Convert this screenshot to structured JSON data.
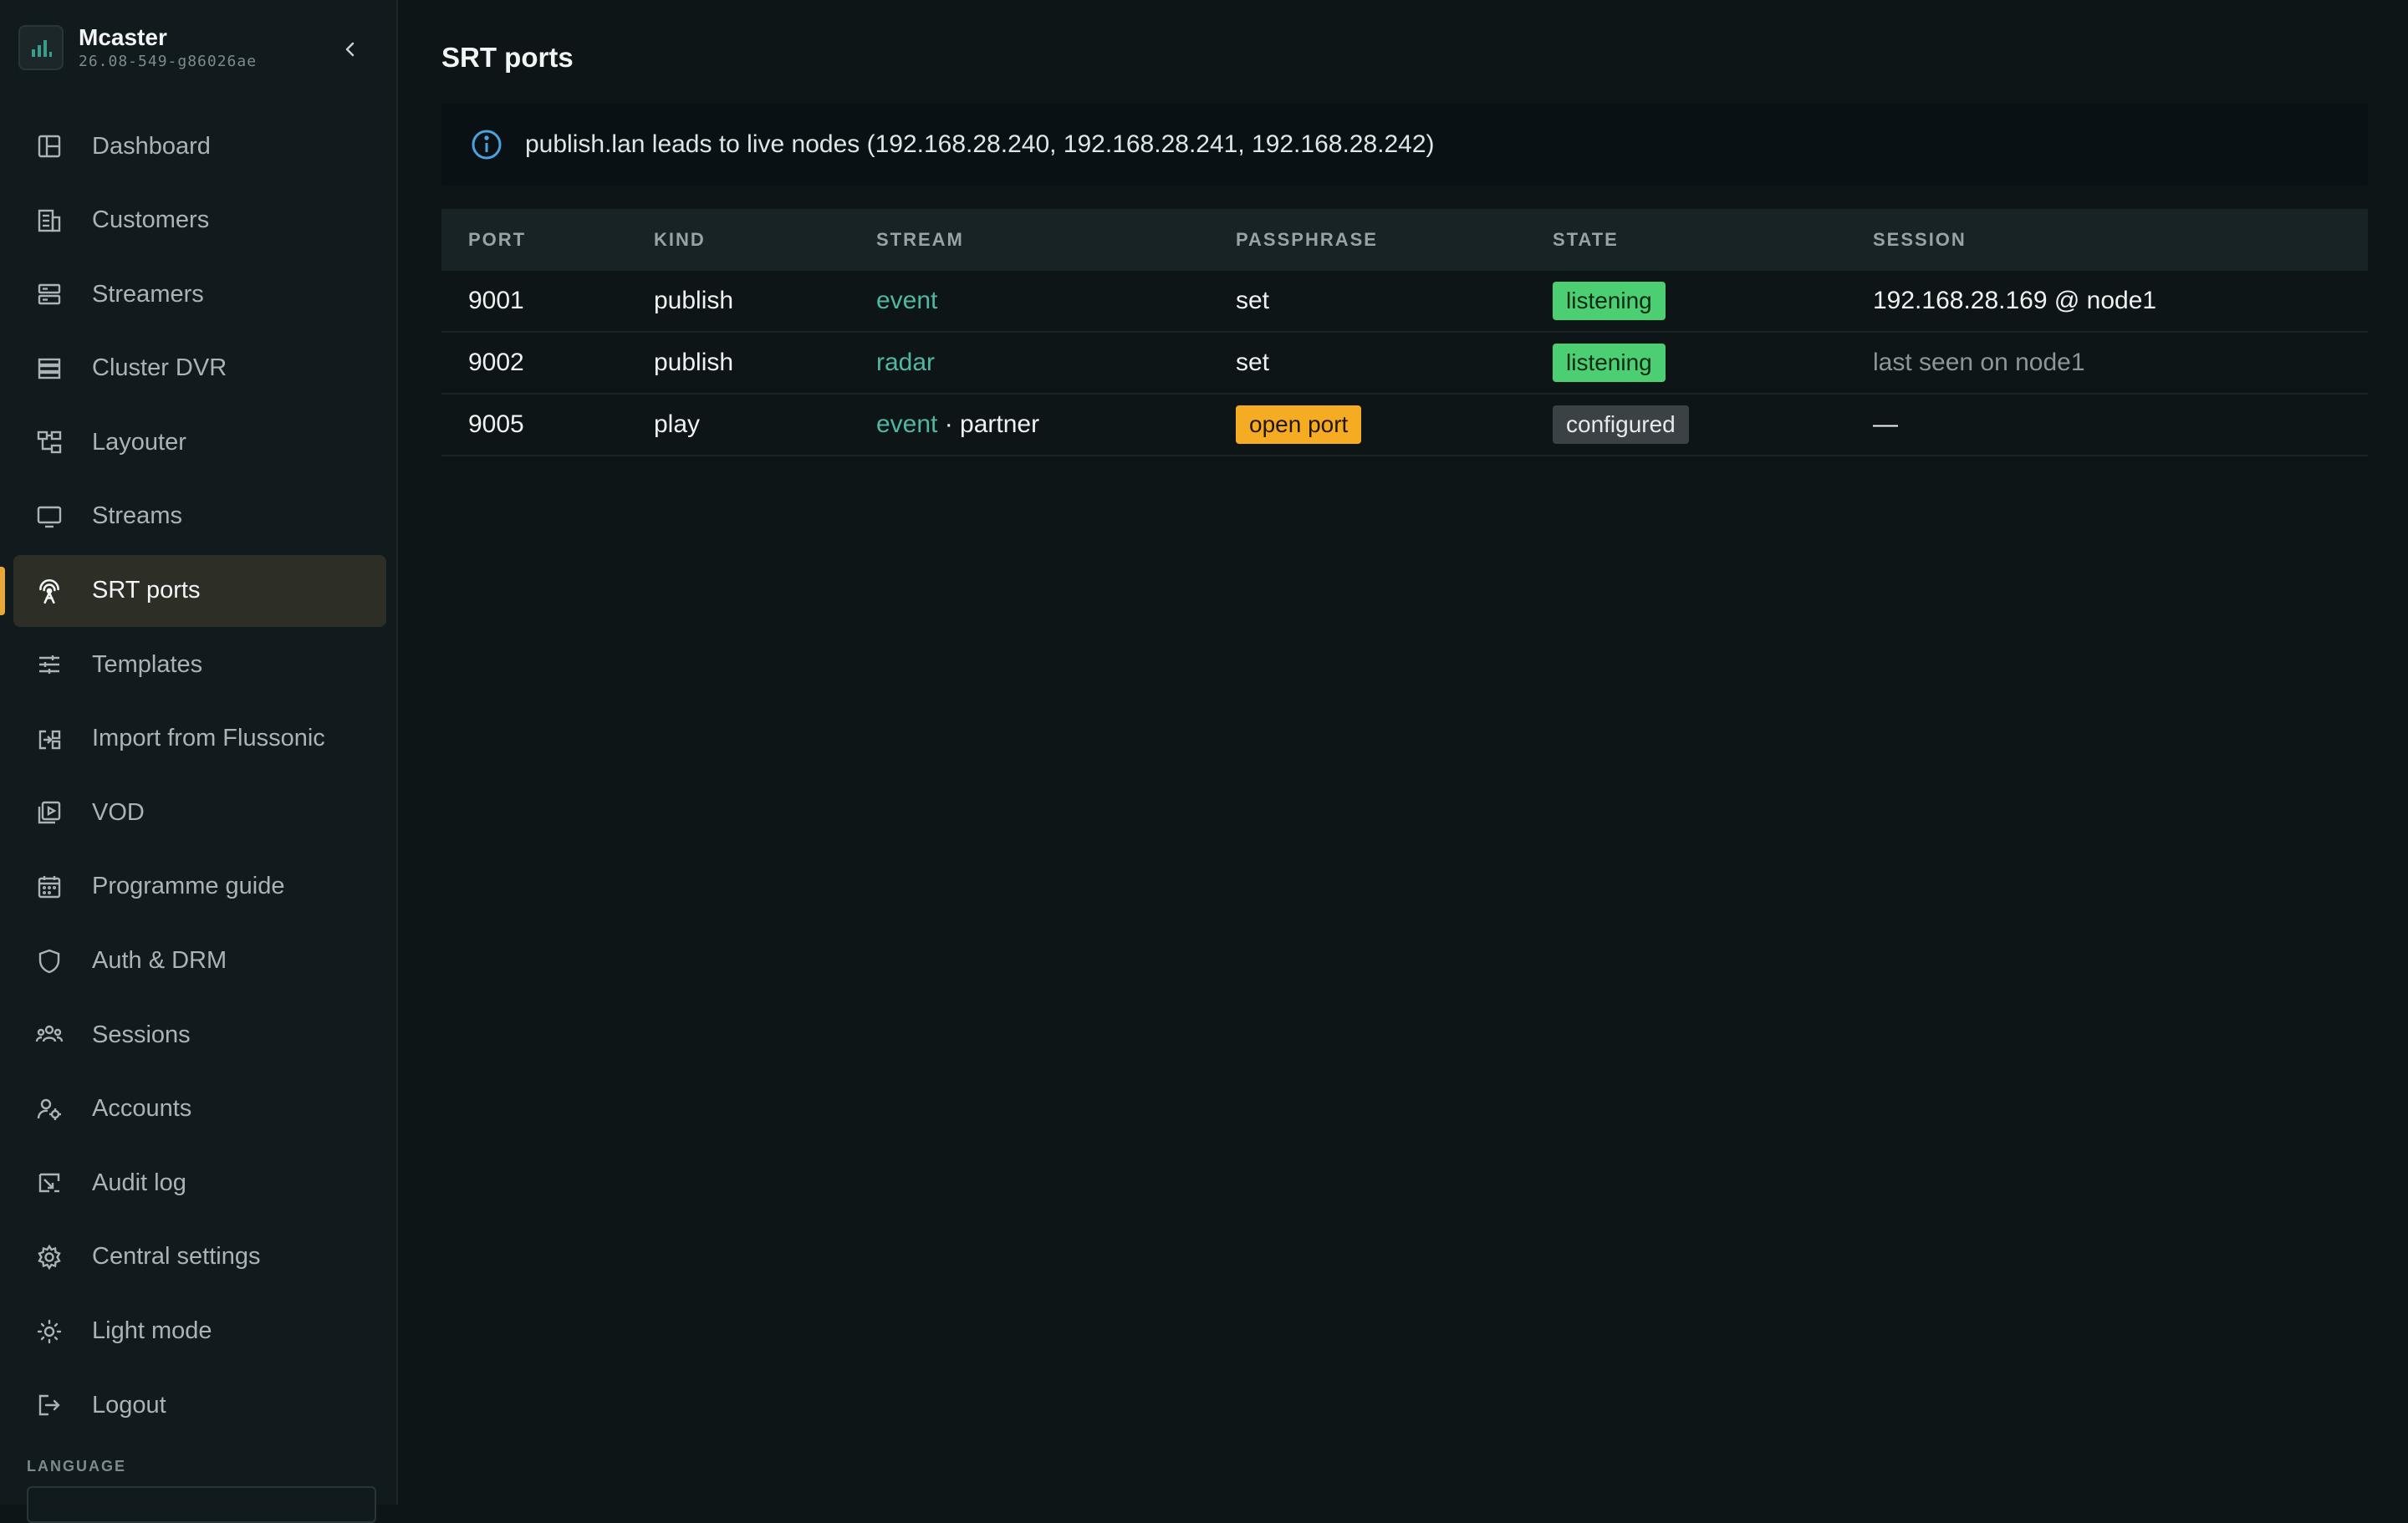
{
  "app": {
    "name": "Mcaster",
    "version": "26.08-549-g86026ae"
  },
  "sidebar": {
    "items": [
      {
        "label": "Dashboard",
        "icon": "dashboard-icon"
      },
      {
        "label": "Customers",
        "icon": "building-icon"
      },
      {
        "label": "Streamers",
        "icon": "server-icon"
      },
      {
        "label": "Cluster DVR",
        "icon": "storage-icon"
      },
      {
        "label": "Layouter",
        "icon": "layout-icon"
      },
      {
        "label": "Streams",
        "icon": "monitor-icon"
      },
      {
        "label": "SRT ports",
        "icon": "antenna-icon",
        "active": true
      },
      {
        "label": "Templates",
        "icon": "sliders-icon"
      },
      {
        "label": "Import from Flussonic",
        "icon": "import-icon"
      },
      {
        "label": "VOD",
        "icon": "play-icon"
      },
      {
        "label": "Programme guide",
        "icon": "calendar-icon"
      },
      {
        "label": "Auth & DRM",
        "icon": "shield-icon"
      },
      {
        "label": "Sessions",
        "icon": "users-icon"
      },
      {
        "label": "Accounts",
        "icon": "user-gear-icon"
      },
      {
        "label": "Audit log",
        "icon": "audit-icon"
      },
      {
        "label": "Central settings",
        "icon": "gear-icon"
      },
      {
        "label": "Light mode",
        "icon": "sun-icon"
      },
      {
        "label": "Logout",
        "icon": "logout-icon"
      }
    ],
    "language_label": "LANGUAGE"
  },
  "main": {
    "title": "SRT ports",
    "info": "publish.lan leads to live nodes (192.168.28.240, 192.168.28.241, 192.168.28.242)",
    "table": {
      "headers": [
        "PORT",
        "KIND",
        "STREAM",
        "PASSPHRASE",
        "STATE",
        "SESSION"
      ],
      "rows": [
        {
          "port": "9001",
          "kind": "publish",
          "stream": "event",
          "stream_suffix": "",
          "passphrase": "set",
          "state": "listening",
          "session": "192.168.28.169 @ node1"
        },
        {
          "port": "9002",
          "kind": "publish",
          "stream": "radar",
          "stream_suffix": "",
          "passphrase": "set",
          "state": "listening",
          "session": "last seen on node1"
        },
        {
          "port": "9005",
          "kind": "play",
          "stream": "event",
          "stream_suffix": " · partner",
          "passphrase": "open port",
          "state": "configured",
          "session": "—"
        }
      ]
    }
  },
  "colors": {
    "accent": "#e8a73a",
    "link": "#4fb8a3",
    "state_listening": "#4ccf73",
    "passphrase_open": "#f5ab22",
    "state_configured": "#3a4245"
  }
}
